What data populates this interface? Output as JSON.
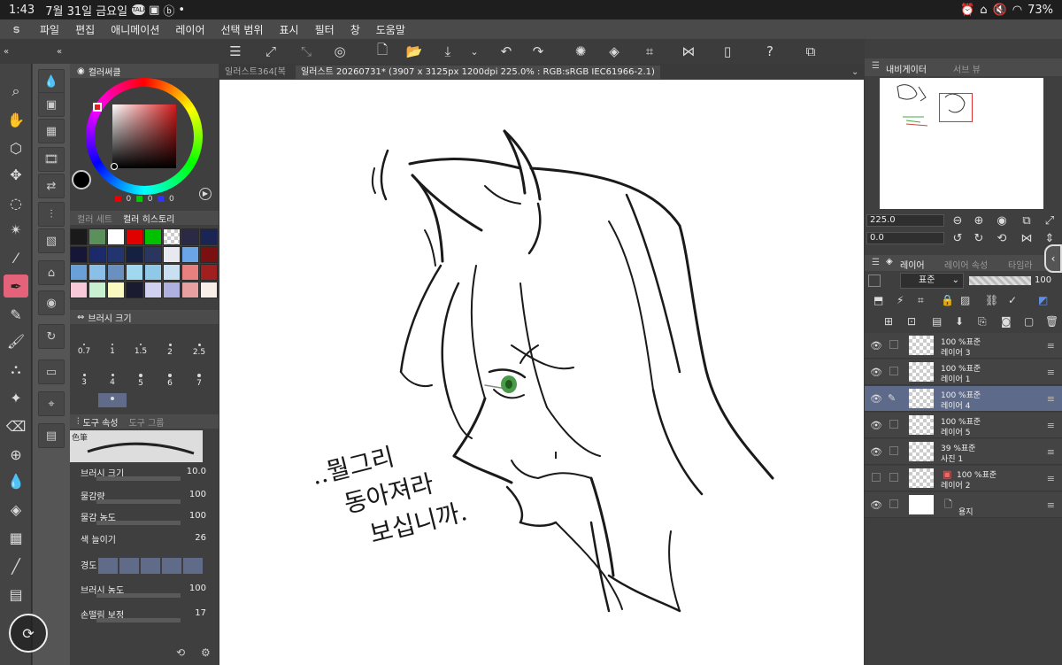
{
  "status": {
    "time": "1:43",
    "date": "7월 31일 금요일",
    "badge_talk": "TALK",
    "battery": "73%"
  },
  "menu": [
    "파일",
    "편집",
    "애니메이션",
    "레이어",
    "선택 범위",
    "표시",
    "필터",
    "창",
    "도움말"
  ],
  "tabs": {
    "tab1": "일러스트364[복",
    "tab2": "일러스트 20260731* (3907 x 3125px 1200dpi 225.0% : RGB:sRGB IEC61966-2.1)"
  },
  "color_panel": {
    "title": "컬러써클",
    "rgb": [
      "0",
      "0",
      "0"
    ],
    "colors": {
      "accent_tool": "#e5637a",
      "selection": "#5e6a8a"
    }
  },
  "swatch_panel": {
    "tab1": "컬러 세트",
    "tab2": "컬러 히스토리",
    "swatches": [
      "#1a1a1a",
      "#5b8f5b",
      "#ffffff",
      "#e00000",
      "#00c000",
      "checker",
      "#2a2a44",
      "#1a2555",
      "#161638",
      "#1a2a6a",
      "#233570",
      "#162040",
      "#2a3560",
      "#e8e8f0",
      "#6aa5e8",
      "#7a1010",
      "#6aa0d8",
      "#8ac0e8",
      "#6a90c0",
      "#a0d8f0",
      "#90c8e8",
      "#c8e0f0",
      "#e88080",
      "#a02020",
      "#f8c8d8",
      "#c8f0d0",
      "#f8f8c0",
      "#1a1a30",
      "#d0d0f0",
      "#b0b0e0",
      "#e8a0a0",
      "#f8f0e8"
    ]
  },
  "brush_size": {
    "title": "브러시 크기",
    "sizes": [
      "0.7",
      "1",
      "1.5",
      "2",
      "2.5",
      "3",
      "4",
      "5",
      "6",
      "7"
    ]
  },
  "tool_property": {
    "tab1": "도구 속성",
    "tab2": "도구 그룹",
    "preview_label": "色筆",
    "props": [
      {
        "label": "브러시 크기",
        "value": "10.0"
      },
      {
        "label": "물감량",
        "value": "100"
      },
      {
        "label": "물감 농도",
        "value": "100"
      },
      {
        "label": "색 늘이기",
        "value": "26"
      },
      {
        "label": "경도",
        "value": ""
      },
      {
        "label": "브러시 농도",
        "value": "100"
      },
      {
        "label": "손떨림 보정",
        "value": "17"
      }
    ]
  },
  "navigator": {
    "tab1": "내비게이터",
    "tab2": "서브 뷰",
    "zoom": "225.0",
    "angle": "0.0"
  },
  "layers_panel": {
    "tab1": "레이어",
    "tab2": "레이어 속성",
    "tab3": "타임라",
    "blend": "표준",
    "opacity": "100",
    "layers": [
      {
        "line1": "100 %표준",
        "line2": "레이어 3",
        "visible": true,
        "selected": false
      },
      {
        "line1": "100 %표준",
        "line2": "레이어 1",
        "visible": true,
        "selected": false
      },
      {
        "line1": "100 %표준",
        "line2": "레이어 4",
        "visible": true,
        "selected": true
      },
      {
        "line1": "100 %표준",
        "line2": "레이어 5",
        "visible": true,
        "selected": false
      },
      {
        "line1": "39 %표준",
        "line2": "사진 1",
        "visible": true,
        "selected": false
      },
      {
        "line1": "100 %표준",
        "line2": "레이어 2",
        "visible": false,
        "selected": false
      },
      {
        "line1": "",
        "line2": "용지",
        "visible": true,
        "selected": false
      }
    ]
  },
  "canvas": {
    "handwriting_line1": "..뭘그리",
    "handwriting_line2": "동아져라",
    "handwriting_line3": "보십니까."
  }
}
